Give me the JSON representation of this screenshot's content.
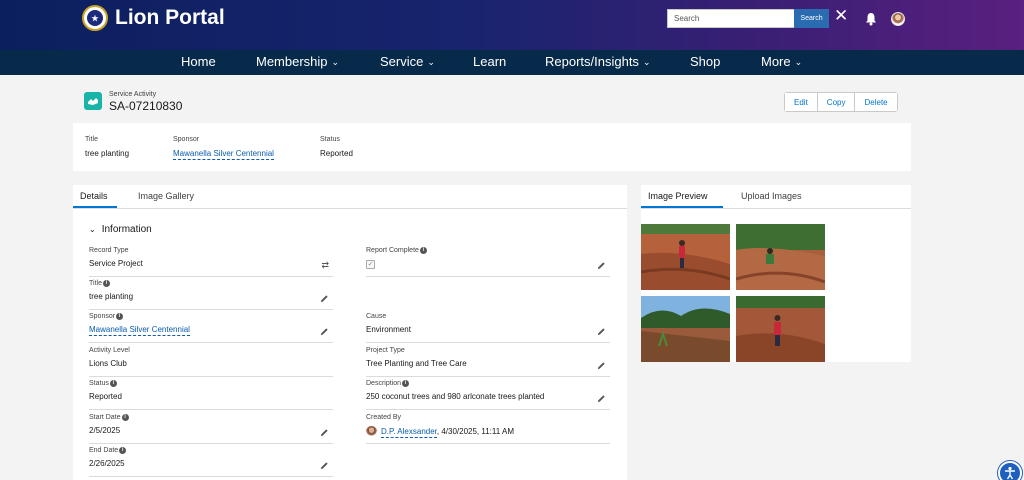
{
  "header": {
    "brand": "Lion Portal",
    "logo_icon": "lions-logo-icon",
    "search_placeholder": "Search",
    "search_button": "Search"
  },
  "nav": {
    "items": [
      {
        "label": "Home",
        "dropdown": false
      },
      {
        "label": "Membership",
        "dropdown": true
      },
      {
        "label": "Service",
        "dropdown": true
      },
      {
        "label": "Learn",
        "dropdown": false
      },
      {
        "label": "Reports/Insights",
        "dropdown": true
      },
      {
        "label": "Shop",
        "dropdown": false
      },
      {
        "label": "More",
        "dropdown": true
      }
    ]
  },
  "record": {
    "type": "Service Activity",
    "id": "SA-07210830",
    "actions": {
      "edit": "Edit",
      "copy": "Copy",
      "delete": "Delete"
    }
  },
  "highlights": {
    "title_label": "Title",
    "title_value": "tree planting",
    "sponsor_label": "Sponsor",
    "sponsor_value": "Mawanella Silver Centennial",
    "status_label": "Status",
    "status_value": "Reported"
  },
  "details": {
    "tabs": [
      "Details",
      "Image Gallery"
    ],
    "section": "Information",
    "left": {
      "record_type": {
        "label": "Record Type",
        "value": "Service Project"
      },
      "title": {
        "label": "Title",
        "value": "tree planting"
      },
      "sponsor": {
        "label": "Sponsor",
        "value": "Mawanella Silver Centennial"
      },
      "activity_level": {
        "label": "Activity Level",
        "value": "Lions Club"
      },
      "status": {
        "label": "Status",
        "value": "Reported"
      },
      "start_date": {
        "label": "Start Date",
        "value": "2/5/2025"
      },
      "end_date": {
        "label": "End Date",
        "value": "2/26/2025"
      }
    },
    "right": {
      "report_complete": {
        "label": "Report Complete",
        "checked": true
      },
      "cause": {
        "label": "Cause",
        "value": "Environment"
      },
      "project_type": {
        "label": "Project Type",
        "value": "Tree Planting and Tree Care"
      },
      "description": {
        "label": "Description",
        "value": "250 coconut trees and 980 arlconate trees planted"
      },
      "created_by": {
        "label": "Created By",
        "user": "D.P. Alexsander",
        "date": ", 4/30/2025, 11:11 AM"
      }
    }
  },
  "preview": {
    "tabs": [
      "Image Preview",
      "Upload Images"
    ]
  },
  "colors": {
    "header_start": "#0b1f5e",
    "header_end": "#5a1f80",
    "nav_bg": "#082a4a",
    "accent": "#0176d3",
    "record_icon": "#18b4a8"
  }
}
